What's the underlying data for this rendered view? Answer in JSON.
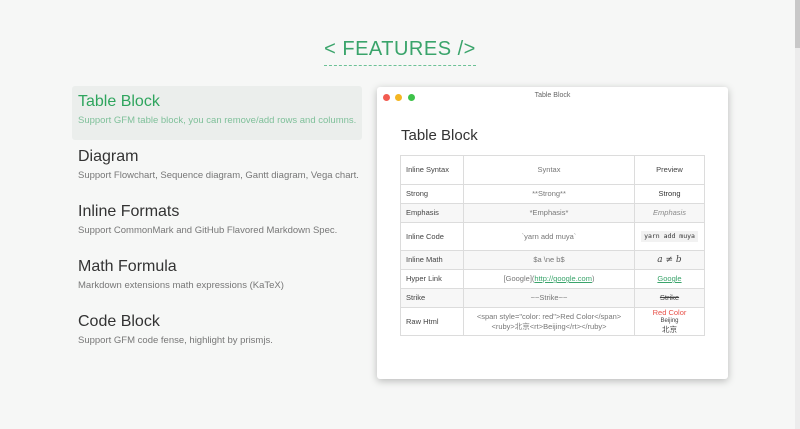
{
  "header": {
    "title": "< FEATURES />"
  },
  "features": [
    {
      "title": "Table Block",
      "desc": "Support GFM table block, you can remove/add rows and columns."
    },
    {
      "title": "Diagram",
      "desc": "Support Flowchart, Sequence diagram, Gantt diagram, Vega chart."
    },
    {
      "title": "Inline Formats",
      "desc": "Support CommonMark and GitHub Flavored Markdown Spec."
    },
    {
      "title": "Math Formula",
      "desc": "Markdown extensions math expressions (KaTeX)"
    },
    {
      "title": "Code Block",
      "desc": "Support GFM code fense, highlight by prismjs."
    }
  ],
  "window": {
    "title": "Table Block",
    "heading": "Table Block",
    "table": {
      "headers": [
        "Inline Syntax",
        "Syntax",
        "Preview"
      ],
      "rows": [
        {
          "name": "Strong",
          "syntax": "**Strong**",
          "preview": "Strong"
        },
        {
          "name": "Emphasis",
          "syntax": "*Emphasis*",
          "preview": "Emphasis"
        },
        {
          "name": "Inline Code",
          "syntax": "`yarn add muya`",
          "preview": "yarn add muya"
        },
        {
          "name": "Inline Math",
          "syntax": "$a \\ne b$",
          "preview": "a ≠ b"
        },
        {
          "name": "Hyper Link",
          "syntax": "[Google](http://google.com)",
          "syntax_url": "http://google.com",
          "syntax_text": "[Google]",
          "preview": "Google"
        },
        {
          "name": "Strike",
          "syntax": "~~Strike~~",
          "preview": "Strike"
        },
        {
          "name": "Raw Html",
          "syntax": "<span style=\"color: red\">Red Color</span> <ruby>北京<rt>Beijing</rt></ruby>",
          "preview": "Red Color",
          "preview_rt": "Beijing",
          "preview_base": "北京"
        }
      ]
    }
  },
  "colors": {
    "accent": "#3aa46b",
    "red": "#e8524a"
  }
}
